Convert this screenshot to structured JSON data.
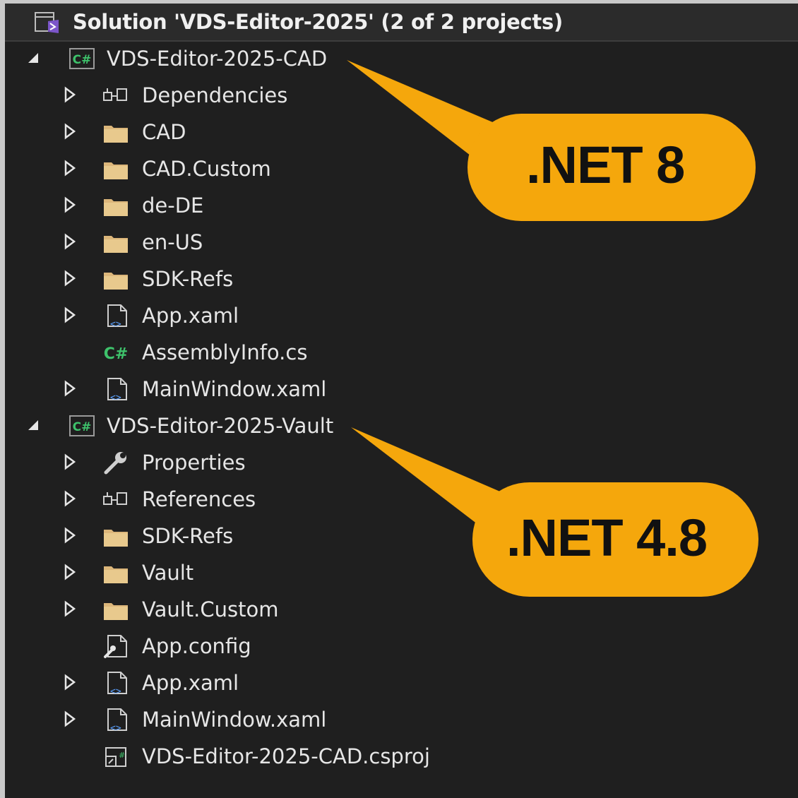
{
  "solution": {
    "title": "Solution 'VDS-Editor-2025' (2 of 2 projects)",
    "icon": "solution-icon"
  },
  "tree": {
    "project_cad": {
      "label": "VDS-Editor-2025-CAD",
      "icon": "csharp-project-icon",
      "expanded": true,
      "items": [
        {
          "label": "Dependencies",
          "icon": "dependencies-icon",
          "expandable": true
        },
        {
          "label": "CAD",
          "icon": "folder-icon",
          "expandable": true
        },
        {
          "label": "CAD.Custom",
          "icon": "folder-icon",
          "expandable": true
        },
        {
          "label": "de-DE",
          "icon": "folder-icon",
          "expandable": true
        },
        {
          "label": "en-US",
          "icon": "folder-icon",
          "expandable": true
        },
        {
          "label": "SDK-Refs",
          "icon": "folder-icon",
          "expandable": true
        },
        {
          "label": "App.xaml",
          "icon": "xaml-file-icon",
          "expandable": true
        },
        {
          "label": "AssemblyInfo.cs",
          "icon": "csharp-file-icon",
          "expandable": false
        },
        {
          "label": "MainWindow.xaml",
          "icon": "xaml-file-icon",
          "expandable": true
        }
      ]
    },
    "project_vault": {
      "label": "VDS-Editor-2025-Vault",
      "icon": "csharp-project-icon",
      "expanded": true,
      "items": [
        {
          "label": "Properties",
          "icon": "wrench-icon",
          "expandable": true
        },
        {
          "label": "References",
          "icon": "references-icon",
          "expandable": true
        },
        {
          "label": "SDK-Refs",
          "icon": "folder-icon",
          "expandable": true
        },
        {
          "label": "Vault",
          "icon": "folder-icon",
          "expandable": true
        },
        {
          "label": "Vault.Custom",
          "icon": "folder-icon",
          "expandable": true
        },
        {
          "label": "App.config",
          "icon": "config-file-icon",
          "expandable": false
        },
        {
          "label": "App.xaml",
          "icon": "xaml-file-icon",
          "expandable": true
        },
        {
          "label": "MainWindow.xaml",
          "icon": "xaml-file-icon",
          "expandable": true
        },
        {
          "label": "VDS-Editor-2025-CAD.csproj",
          "icon": "csproj-file-icon",
          "expandable": false
        }
      ]
    }
  },
  "callouts": {
    "cad": ".NET 8",
    "vault": ".NET 4.8"
  },
  "colors": {
    "background": "#1f1f1f",
    "callout": "#f5a70c",
    "folder": "#dcb67a",
    "csharp_green": "#3ec26b"
  }
}
